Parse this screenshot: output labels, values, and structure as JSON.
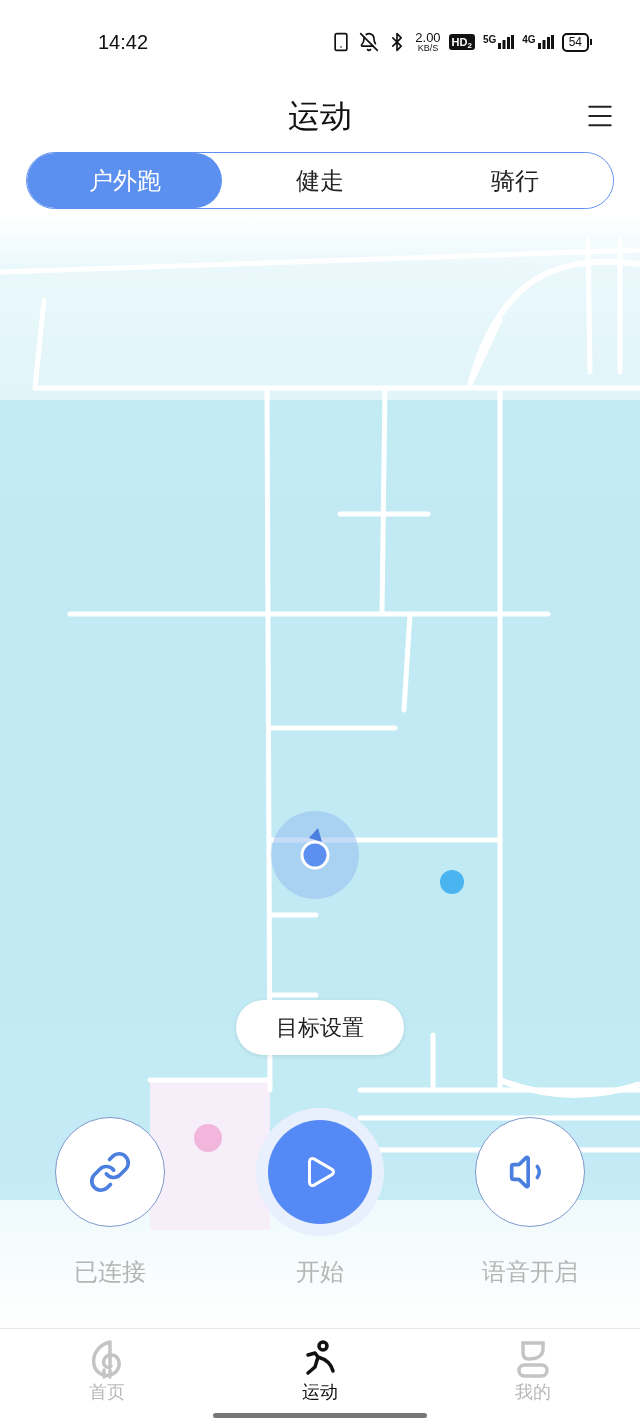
{
  "status_bar": {
    "time": "14:42",
    "speed_value": "2.00",
    "speed_unit": "KB/S",
    "hd": "HD",
    "hd_index": "2",
    "networks": [
      "5G",
      "4G"
    ],
    "battery": "54"
  },
  "header": {
    "title": "运动"
  },
  "tabs": [
    {
      "label": "户外跑",
      "selected": true
    },
    {
      "label": "健走",
      "selected": false
    },
    {
      "label": "骑行",
      "selected": false
    }
  ],
  "goal_button": "目标设置",
  "controls": [
    {
      "kind": "link",
      "label": "已连接"
    },
    {
      "kind": "start",
      "label": "开始"
    },
    {
      "kind": "voice",
      "label": "语音开启"
    }
  ],
  "bottom_nav": [
    {
      "kind": "home",
      "label": "首页",
      "selected": false
    },
    {
      "kind": "sport",
      "label": "运动",
      "selected": true
    },
    {
      "kind": "me",
      "label": "我的",
      "selected": false
    }
  ]
}
